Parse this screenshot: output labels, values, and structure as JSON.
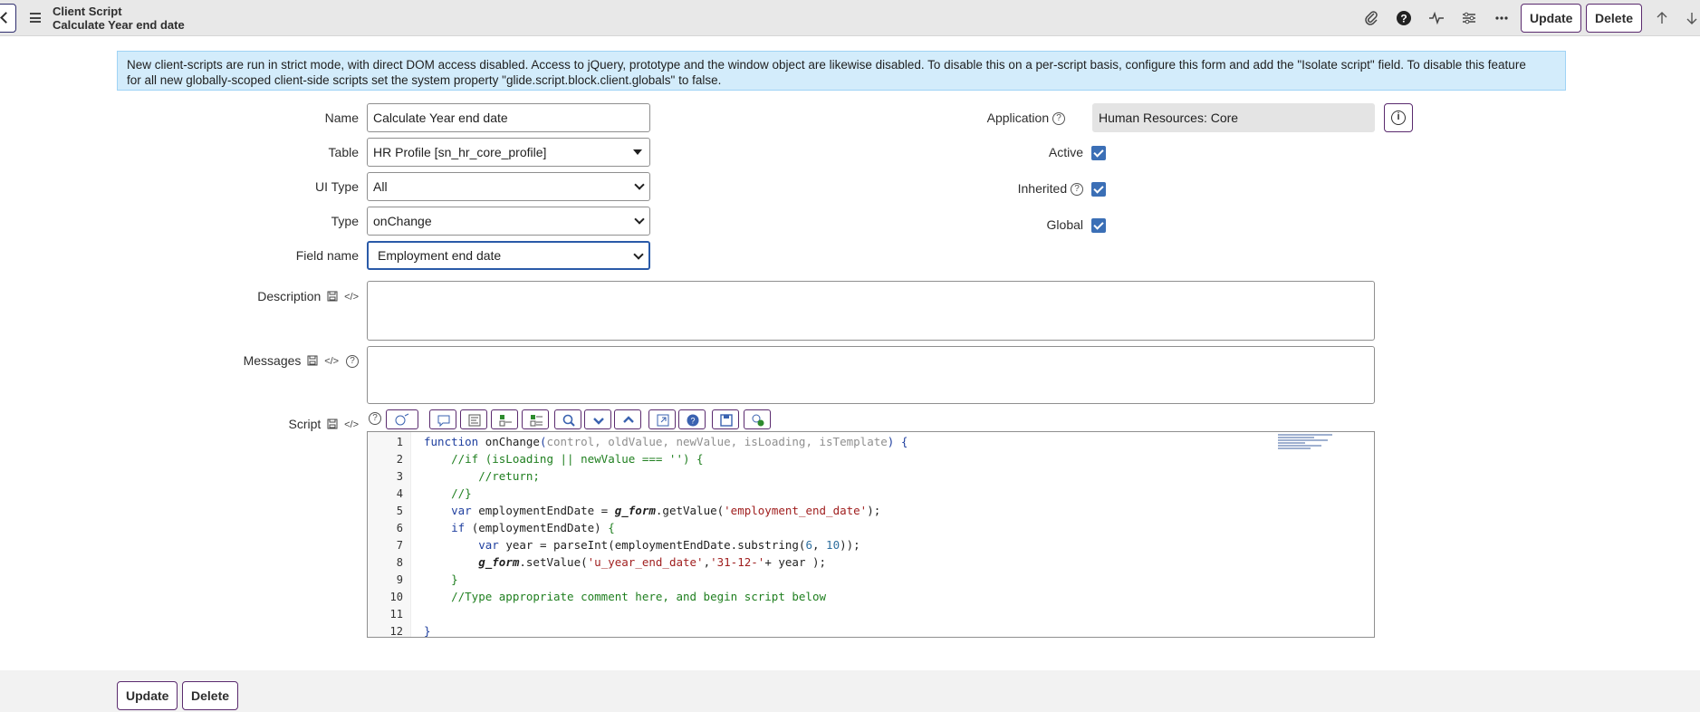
{
  "header": {
    "title": "Client Script",
    "subtitle": "Calculate Year end date",
    "update_label": "Update",
    "delete_label": "Delete"
  },
  "banner": {
    "line1": "New client-scripts are run in strict mode, with direct DOM access disabled. Access to jQuery, prototype and the window object are likewise disabled. To disable this on a per-script basis, configure this form and add the \"Isolate script\" field. To disable this feature",
    "line2": "for all new globally-scoped client-side scripts set the system property \"glide.script.block.client.globals\" to false."
  },
  "form": {
    "name_label": "Name",
    "name_value": "Calculate Year end date",
    "table_label": "Table",
    "table_value": "HR Profile [sn_hr_core_profile]",
    "ui_type_label": "UI Type",
    "ui_type_value": "All",
    "type_label": "Type",
    "type_value": "onChange",
    "field_name_label": "Field name",
    "field_name_value": "Employment end date",
    "application_label": "Application",
    "application_value": "Human Resources: Core",
    "active_label": "Active",
    "active_checked": true,
    "inherited_label": "Inherited",
    "inherited_checked": true,
    "global_label": "Global",
    "global_checked": true,
    "description_label": "Description",
    "messages_label": "Messages",
    "script_label": "Script"
  },
  "script": {
    "line_numbers": [
      "1",
      "2",
      "3",
      "4",
      "5",
      "6",
      "7",
      "8",
      "9",
      "10",
      "11",
      "12"
    ]
  },
  "footer": {
    "update_label": "Update",
    "delete_label": "Delete"
  }
}
